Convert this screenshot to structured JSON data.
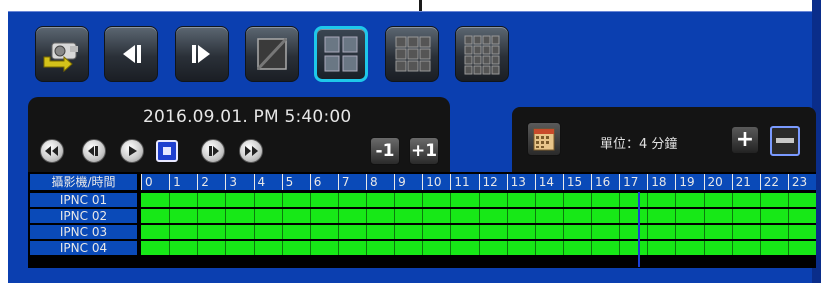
{
  "datetime": "2016.09.01. PM 5:40:00",
  "unit_label": "單位：4 分鐘",
  "step_back_label": "-1",
  "step_forward_label": "+1",
  "zoom_in_label": "+",
  "timeline": {
    "camera_header": "攝影機/時間",
    "hours": [
      "0",
      "1",
      "2",
      "3",
      "4",
      "5",
      "6",
      "7",
      "8",
      "9",
      "10",
      "11",
      "12",
      "13",
      "14",
      "15",
      "16",
      "17",
      "18",
      "19",
      "20",
      "21",
      "22",
      "23"
    ],
    "cameras": [
      "IPNC 01",
      "IPNC 02",
      "IPNC 03",
      "IPNC 04"
    ],
    "recording_color": "#17e817",
    "cursor_hour": 17.66
  },
  "toolbar_icons": [
    "export-camera-icon",
    "prev-frame-icon",
    "next-frame-icon",
    "single-view-icon",
    "quad-view-icon",
    "nine-view-icon",
    "sixteen-view-icon"
  ],
  "colors": {
    "background": "#0b3fb0",
    "accent_selected": "#1ec8ea",
    "cursor": "#1b3fd8"
  }
}
